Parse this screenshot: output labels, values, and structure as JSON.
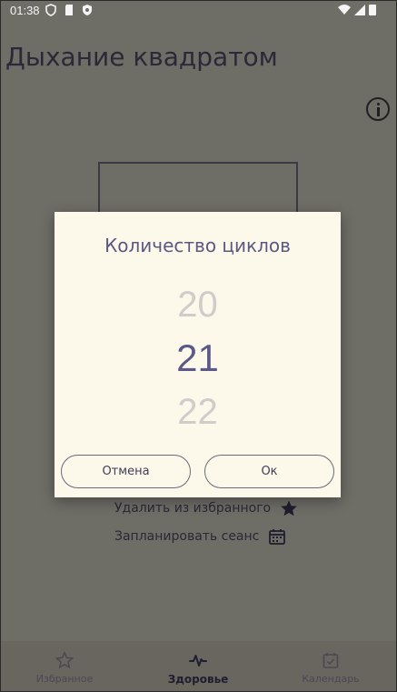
{
  "status_bar": {
    "time": "01:38",
    "icons": [
      "shield-icon",
      "sd-card-icon",
      "security-badge-icon",
      "wifi-icon",
      "signal-icon",
      "battery-icon"
    ]
  },
  "header": {
    "title": "Дыхание квадратом",
    "info_icon": "info-icon"
  },
  "actions": [
    {
      "label": "Удалить из избранного",
      "icon": "star-filled-icon"
    },
    {
      "label": "Запланировать сеанс",
      "icon": "calendar-icon"
    }
  ],
  "dialog": {
    "title": "Количество циклов",
    "picker": {
      "previous": "20",
      "selected": "21",
      "next": "22"
    },
    "cancel_label": "Отмена",
    "ok_label": "Ок"
  },
  "bottom_nav": {
    "items": [
      {
        "label": "Избранное",
        "icon": "star-outline-icon",
        "active": false
      },
      {
        "label": "Здоровье",
        "icon": "heartbeat-icon",
        "active": true
      },
      {
        "label": "Календарь",
        "icon": "calendar-check-icon",
        "active": false
      }
    ]
  },
  "colors": {
    "scrim_background": "#6e6d66",
    "dialog_background": "#fcf9ea",
    "accent": "#5c5887",
    "picker_dim": "#cfccca"
  }
}
